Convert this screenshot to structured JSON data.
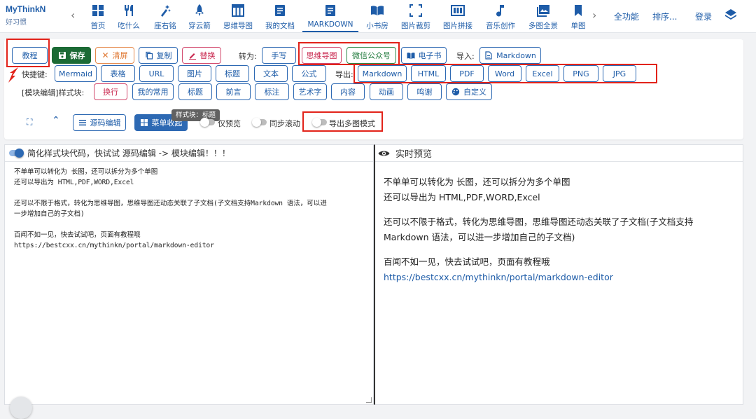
{
  "brand": {
    "name": "MyThinkN",
    "sub": "好习惯"
  },
  "nav": {
    "items": [
      {
        "label": "首页",
        "icon": "grid-icon"
      },
      {
        "label": "吃什么",
        "icon": "fork-knife-icon"
      },
      {
        "label": "座右铭",
        "icon": "sparkle-icon"
      },
      {
        "label": "穿云箭",
        "icon": "rocket-icon"
      },
      {
        "label": "思维导图",
        "icon": "table-icon"
      },
      {
        "label": "我的文档",
        "icon": "document-icon"
      },
      {
        "label": "MARKDOWN",
        "icon": "markdown-doc-icon",
        "active": true
      },
      {
        "label": "小书房",
        "icon": "book-icon"
      },
      {
        "label": "图片裁剪",
        "icon": "crop-icon"
      },
      {
        "label": "图片拼接",
        "icon": "photo-grid-icon"
      },
      {
        "label": "音乐创作",
        "icon": "music-note-icon"
      },
      {
        "label": "多图全景",
        "icon": "images-icon"
      },
      {
        "label": "单图",
        "icon": "bookmark-icon"
      }
    ],
    "all_features": "全功能",
    "sort": "排序...",
    "login": "登录"
  },
  "toolbar": {
    "tutorial": "教程",
    "save": "保存",
    "clear": "清屏",
    "copy": "复制",
    "replace": "替换",
    "convert_label": "转为:",
    "convert": [
      "手写",
      "思维导图",
      "微信公众号",
      "电子书"
    ],
    "import_label": "导入:",
    "import_markdown": "Markdown",
    "shortcut_label": "快捷键:",
    "shortcuts": [
      "Mermaid",
      "表格",
      "URL",
      "图片",
      "标题",
      "文本",
      "公式"
    ],
    "export_label": "导出:",
    "exports": [
      "Markdown",
      "HTML",
      "PDF",
      "Word",
      "Excel",
      "PNG",
      "JPG"
    ],
    "block_label": "[模块编辑]样式块:",
    "blocks": [
      "换行",
      "我的常用",
      "标题",
      "前言",
      "标注",
      "艺术字",
      "内容",
      "动画",
      "鸣谢"
    ],
    "custom": "自定义",
    "source_edit": "源码编辑",
    "menu_collapse": "菜单收起",
    "tooltip": "样式块：标题",
    "preview_only": "仅预览",
    "sync_scroll": "同步滚动",
    "export_multi": "导出多图模式"
  },
  "editor": {
    "header": "简化样式块代码，快试试 源码编辑 -> 模块编辑！！！",
    "lines": [
      "不单单可以转化为 长图，还可以拆分为多个单图",
      "还可以导出为 HTML,PDF,WORD,Excel",
      "还可以不限于格式，转化为思维导图，思维导图还动态关联了子文档(子文档支持Markdown 语法，可以进",
      "一步增加自己的子文档)",
      "百闻不如一见，快去试试吧，页面有教程哦",
      "https://bestcxx.cn/mythinkn/portal/markdown-editor"
    ]
  },
  "preview": {
    "header": "实时预览",
    "p1a": "不单单可以转化为 长图，还可以拆分为多个单图",
    "p1b": "还可以导出为 HTML,PDF,WORD,Excel",
    "p2a": "还可以不限于格式，转化为思维导图，思维导图还动态关联了子文档(子文档支持",
    "p2b": "Markdown 语法，可以进一步增加自己的子文档)",
    "p3": "百闻不如一见，快去试试吧，页面有教程哦",
    "link": "https://bestcxx.cn/mythinkn/portal/markdown-editor"
  }
}
